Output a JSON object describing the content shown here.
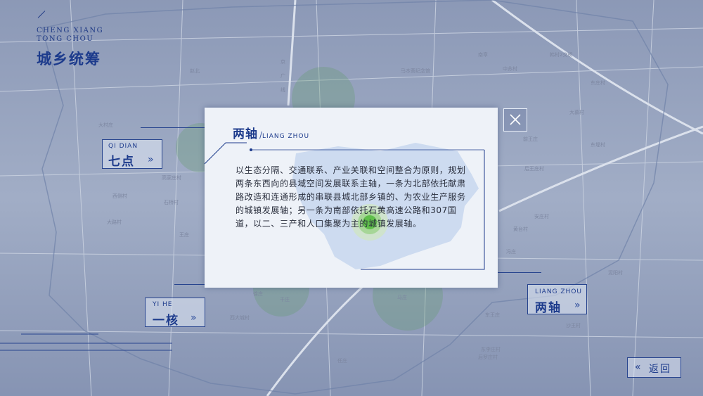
{
  "header": {
    "title_en_line1": "CHENG XIANG",
    "title_en_line2": "TONG CHOU",
    "title_cn": "城乡统筹"
  },
  "nav": {
    "qidian": {
      "en": "QI DIAN",
      "cn": "七点"
    },
    "yihe": {
      "en": "YI HE",
      "cn": "一核"
    },
    "liangzhou": {
      "en": "LIANG ZHOU",
      "cn": "两轴"
    },
    "chevron": "»",
    "back_chevron": "«",
    "back_label": "返回"
  },
  "map": {
    "labels": [
      "京广线",
      "马本斋纪念馆",
      "韩村2交桥",
      "赵北",
      "南章",
      "中苏村",
      "王庄",
      "千庄",
      "马庄",
      "徐庄",
      "冯庄",
      "任庄",
      "东李庄村",
      "后王庄村",
      "后罗庄村",
      "西大城村",
      "黄台村",
      "大路村",
      "西侧村",
      "前王庄",
      "东堤村",
      "石桥村",
      "大慕村",
      "泥阳村",
      "高家庄村",
      "东王庄",
      "沙王村",
      "大村庄",
      "东庄村",
      "安庄村"
    ]
  },
  "modal": {
    "title_cn": "两轴",
    "title_sep": "/",
    "title_en": "LIANG ZHOU",
    "body": "以生态分隔、交通联系、产业关联和空间整合为原则，规划两条东西向的县域空间发展联系主轴，一条为北部依托献肃路改造和连通形成的串联县城北部乡镇的、为农业生产服务的城镇发展轴；另一条为南部依托石黄高速公路和307国道，以二、三产和人口集聚为主的城镇发展轴。"
  },
  "colors": {
    "accent": "#1d3b8c",
    "green": "#4caf50",
    "modal_bg": "#eef2f8"
  }
}
